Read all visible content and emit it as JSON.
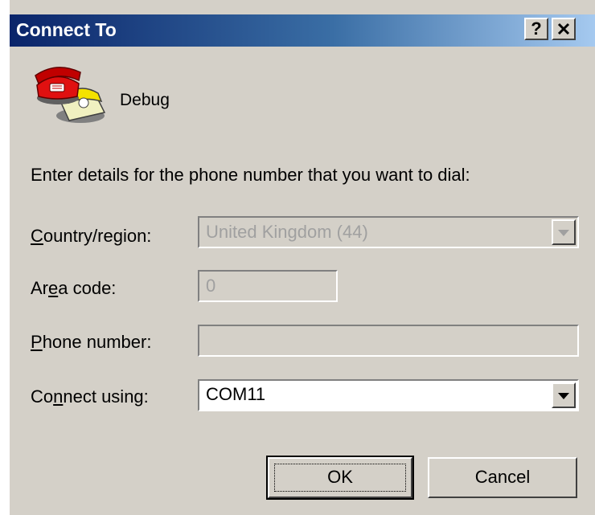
{
  "window": {
    "title": "Connect To",
    "help_label": "?"
  },
  "connection": {
    "name": "Debug",
    "icon": "phone-icon"
  },
  "instructions": "Enter details for the phone number that you want to dial:",
  "fields": {
    "country": {
      "label_prefix": "",
      "label_mnemonic": "C",
      "label_rest": "ountry/region:",
      "value": "United Kingdom (44)",
      "enabled": false
    },
    "area_code": {
      "label_prefix": "Ar",
      "label_mnemonic": "e",
      "label_rest": "a code:",
      "value": "0",
      "enabled": false
    },
    "phone_number": {
      "label_prefix": "",
      "label_mnemonic": "P",
      "label_rest": "hone number:",
      "value": "",
      "enabled": false
    },
    "connect_using": {
      "label_prefix": "Co",
      "label_mnemonic": "n",
      "label_rest": "nect using:",
      "value": "COM11",
      "enabled": true
    }
  },
  "buttons": {
    "ok_label": "OK",
    "cancel_label": "Cancel"
  },
  "colors": {
    "title_start": "#0a246a",
    "title_end": "#a6caf0",
    "dialog_bg": "#d4d0c8"
  }
}
